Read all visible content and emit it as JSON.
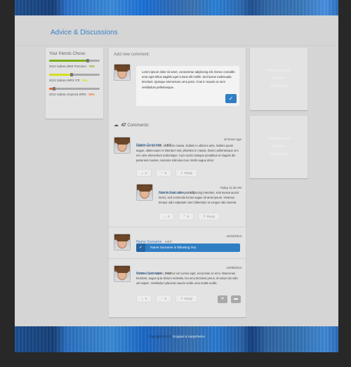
{
  "page": {
    "title": "Advice & Discussions"
  },
  "friends_poll": {
    "heading": "Your friends Chose:",
    "items": [
      {
        "label": "2013 Subaru BRZ Premium:",
        "percent": 76,
        "percent_text": "76%",
        "color": "#7fae1b"
      },
      {
        "label": "2013 Subaru WRX STi:",
        "percent": 45,
        "percent_text": "45%",
        "color": "#d6df1f"
      },
      {
        "label": "2013 Subaru Impreza WRX:",
        "percent": 10,
        "percent_text": "10%",
        "color": "#f06a25"
      }
    ]
  },
  "composer": {
    "label": "Add new comment:",
    "text": "Lorem ipsum dolor sit amet, consectetur adipiscing elit. Donec convallis urna eget tellus sagittis eget cursus elit mollis. Sed luctus malesuada tincidunt. Quisque elementum urna justo. Cras in mauris ac sem vestibulum pellentesque.",
    "submit_icon": "check-icon",
    "submit_glyph": "✓"
  },
  "comments_header": {
    "icon": "speech-bubbles-icon",
    "glyph": "💬",
    "count": "47",
    "label": "Comments:"
  },
  "comments": [
    {
      "name": "Name Surname",
      "said": "said:",
      "time": "10 hours ago",
      "body": "Nullam non dui nibh, at dictum massa. Nullam in ultricies ante. Nullam quam augue, ullamcorper et interdum sed, pharetra in massa. Donec pellentesque orci nec sem elementum scelerisque. Cum sociis natoque penatibus et magnis dis parturient montes, nascetur ridiculus mus. Morbi augue dolor.",
      "down": "4",
      "up": "6",
      "reply": "Reply"
    },
    {
      "name": "Name Surname",
      "said": "said:",
      "time": "Today 11:45 AM",
      "body": "Cras rhoncus, odio quis adipiscing interdum, erat massa auctor lorem, sed commodo lectus augue sit amet ipsum. Vivamus tempor odio vulputate nunc bibendum ut congue odio laoreet.",
      "down": "4",
      "up": "6",
      "reply": "Reply"
    },
    {
      "name": "Name Surname",
      "said": "said:",
      "time": "10/10/2013",
      "follow_text": "Name Surname is following You.",
      "follow_glyph": "✓"
    },
    {
      "name": "Name Surname",
      "said": "said:",
      "time": "12/05/2013",
      "body": "Vivamus nunc sapien, rhoncus vel cursus eget, accumsan ac arcu. Maecenas tincidunt, augue quis dictum molestie, leo arcu tincidunt purus, id varius dui odio vel sapien. Vestibulum placerat mauris mollis urna mattis mollis.",
      "down": "4",
      "up": "6",
      "reply": "Reply",
      "delete_glyph": "✕",
      "flag_glyph": "▬"
    }
  ],
  "action_glyphs": {
    "down": "⌄",
    "up": "⌃",
    "reply": "↰"
  },
  "ads": [
    {
      "line1": "Advertisement",
      "line2": "Banner",
      "line3": "230x250px"
    },
    {
      "line1": "Advertisement",
      "line2": "Banner",
      "line3": "230x250px"
    }
  ],
  "footer": {
    "copyright": "Copyright 2013 ©",
    "brand": "Dropped & SanjaPavlov"
  }
}
